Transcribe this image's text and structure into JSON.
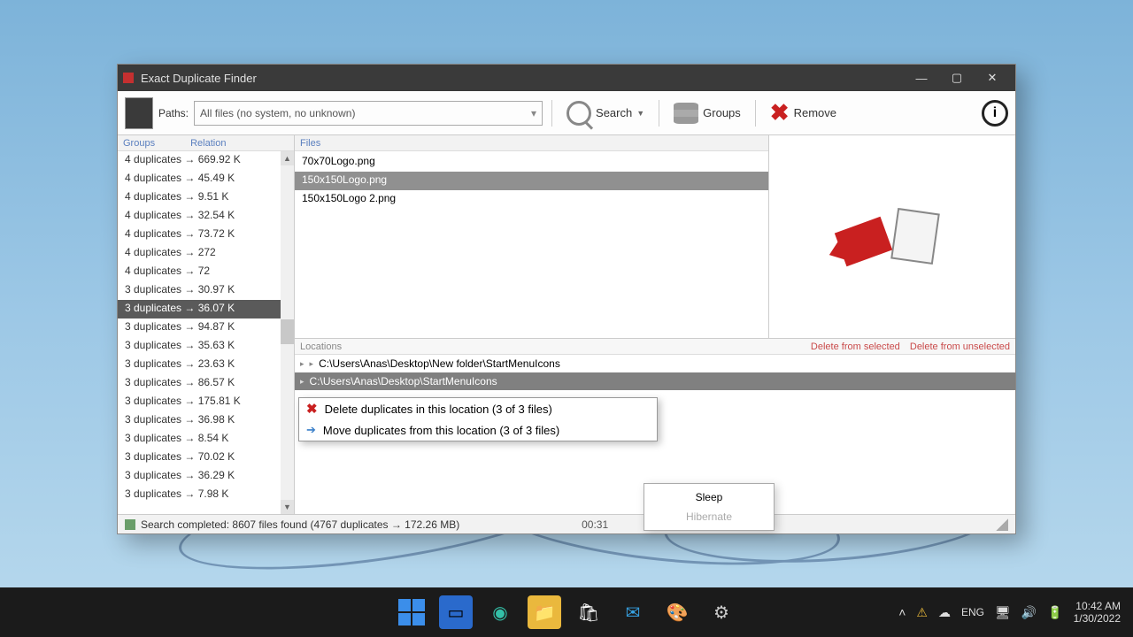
{
  "window": {
    "title": "Exact Duplicate Finder",
    "toolbar": {
      "paths_label": "Paths:",
      "filter_text": "All files (no system, no unknown)",
      "search_label": "Search",
      "groups_label": "Groups",
      "remove_label": "Remove"
    },
    "groups_header": {
      "col1": "Groups",
      "col2": "Relation"
    },
    "groups": [
      "4 duplicates → 669.92 K",
      "4 duplicates → 45.49 K",
      "4 duplicates → 9.51 K",
      "4 duplicates → 32.54 K",
      "4 duplicates → 73.72 K",
      "4 duplicates → 272",
      "4 duplicates → 72",
      "3 duplicates → 30.97 K",
      "3 duplicates → 36.07 K",
      "3 duplicates → 94.87 K",
      "3 duplicates → 35.63 K",
      "3 duplicates → 23.63 K",
      "3 duplicates → 86.57 K",
      "3 duplicates → 175.81 K",
      "3 duplicates → 36.98 K",
      "3 duplicates → 8.54 K",
      "3 duplicates → 70.02 K",
      "3 duplicates → 36.29 K",
      "3 duplicates → 7.98 K"
    ],
    "groups_selected_index": 8,
    "files_header": "Files",
    "files": [
      "70x70Logo.png",
      "150x150Logo.png",
      "150x150Logo 2.png"
    ],
    "files_selected_index": 1,
    "locations_header": {
      "label": "Locations",
      "link_selected": "Delete from selected",
      "link_unselected": "Delete from unselected"
    },
    "locations": [
      "C:\\Users\\Anas\\Desktop\\New folder\\StartMenuIcons",
      "C:\\Users\\Anas\\Desktop\\StartMenuIcons"
    ],
    "locations_selected_index": 1,
    "context_menu": {
      "delete_label": "Delete duplicates in this location (3 of 3 files)",
      "move_label": "Move duplicates from this location (3 of 3 files)"
    },
    "power_menu": {
      "sleep": "Sleep",
      "hibernate": "Hibernate"
    },
    "status": {
      "text": "Search completed: 8607 files found (4767 duplicates → 172.26 MB)",
      "time": "00:31"
    }
  },
  "taskbar": {
    "lang": "ENG",
    "time": "10:42 AM",
    "date": "1/30/2022"
  }
}
